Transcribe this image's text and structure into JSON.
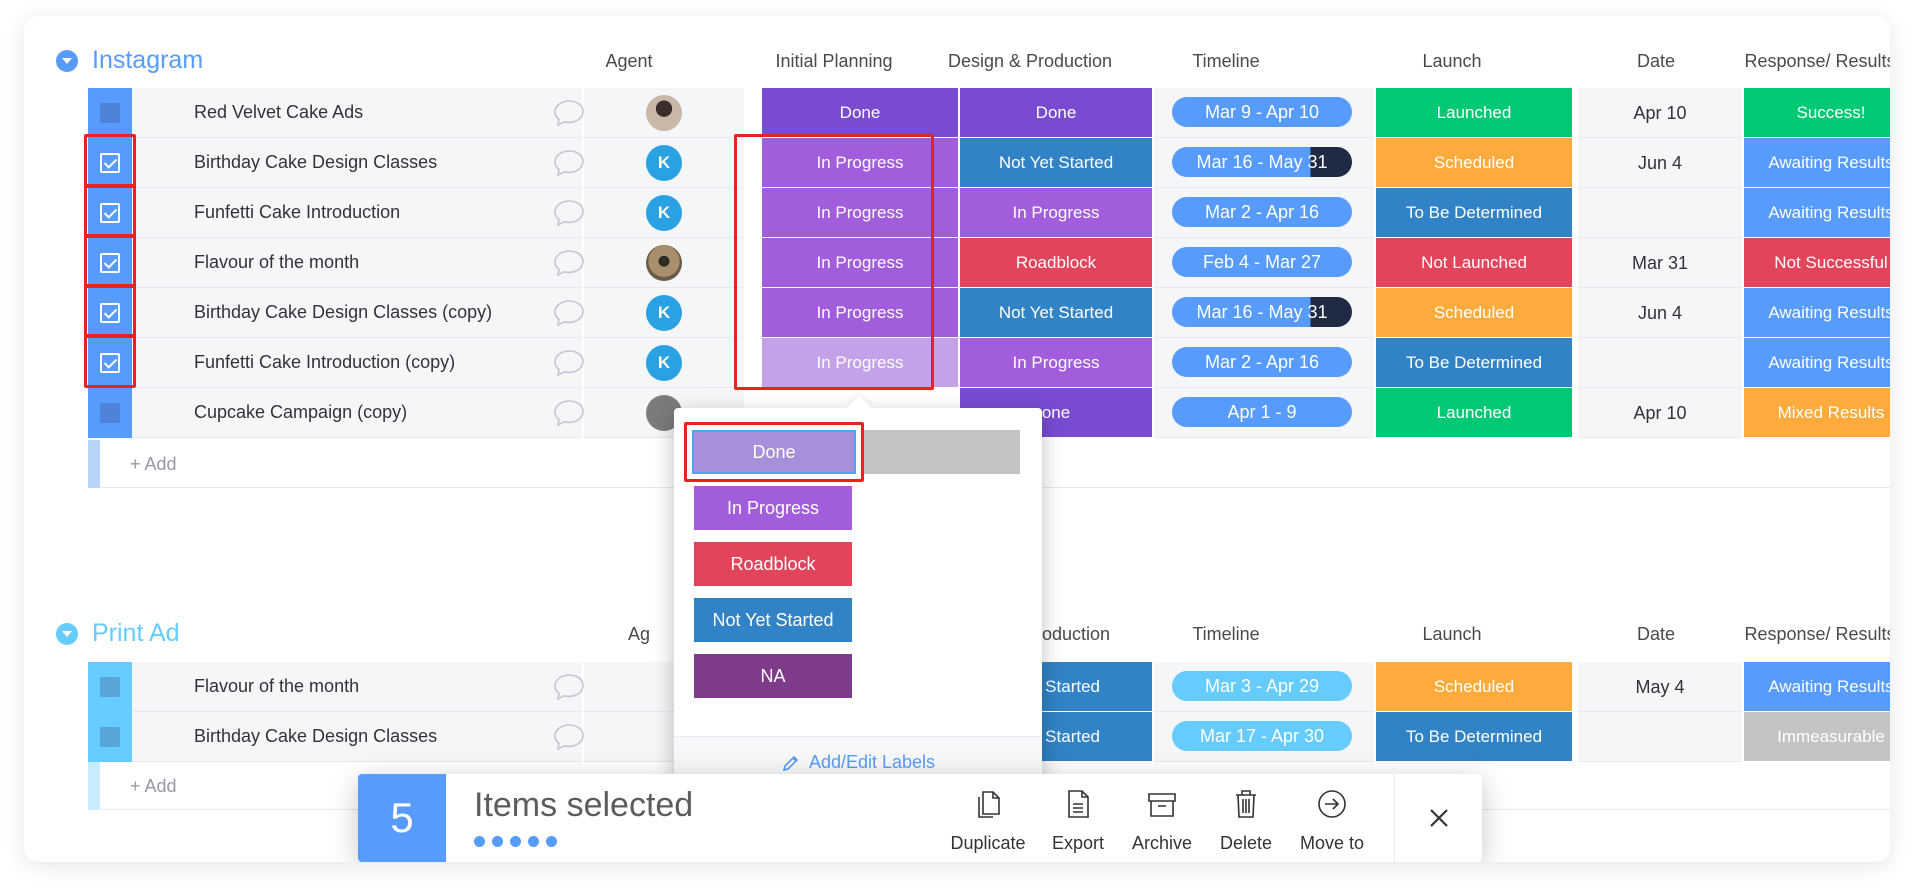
{
  "groups": [
    {
      "title": "Instagram",
      "columns": [
        "Agent",
        "Initial Planning",
        "Design & Production",
        "Timeline",
        "Launch",
        "Date",
        "Response/ Results"
      ],
      "rows": [
        {
          "name": "Red Velvet Cake Ads",
          "checked": false,
          "agent": "photo",
          "initial": "Done",
          "design": "Done",
          "timeline": "Mar 9 - Apr 10",
          "launch": "Launched",
          "date": "Apr 10",
          "response": "Success!"
        },
        {
          "name": "Birthday Cake Design Classes",
          "checked": true,
          "agent": "K",
          "initial": "In Progress",
          "design": "Not Yet Started",
          "timeline": "Mar 16 - May 31",
          "launch": "Scheduled",
          "date": "Jun 4",
          "response": "Awaiting Results"
        },
        {
          "name": "Funfetti Cake Introduction",
          "checked": true,
          "agent": "K",
          "initial": "In Progress",
          "design": "In Progress",
          "timeline": "Mar 2 - Apr 16",
          "launch": "To Be Determined",
          "date": "",
          "response": "Awaiting Results"
        },
        {
          "name": "Flavour of the month",
          "checked": true,
          "agent": "pug",
          "initial": "In Progress",
          "design": "Roadblock",
          "timeline": "Feb 4 - Mar 27",
          "launch": "Not Launched",
          "date": "Mar 31",
          "response": "Not Successful"
        },
        {
          "name": "Birthday Cake Design Classes (copy)",
          "checked": true,
          "agent": "K",
          "initial": "In Progress",
          "design": "Not Yet Started",
          "timeline": "Mar 16 - May 31",
          "launch": "Scheduled",
          "date": "Jun 4",
          "response": "Awaiting Results"
        },
        {
          "name": "Funfetti Cake Introduction (copy)",
          "checked": true,
          "agent": "K",
          "initial": "In Progress",
          "design": "In Progress",
          "timeline": "Mar 2 - Apr 16",
          "launch": "To Be Determined",
          "date": "",
          "response": "Awaiting Results"
        },
        {
          "name": "Cupcake Campaign (copy)",
          "checked": false,
          "agent": "",
          "initial": "",
          "design": "one",
          "timeline": "Apr 1 - 9",
          "launch": "Launched",
          "date": "Apr 10",
          "response": "Mixed Results"
        }
      ],
      "add_label": "+ Add"
    },
    {
      "title": "Print Ad",
      "columns": [
        "Ag",
        "Production",
        "Timeline",
        "Launch",
        "Date",
        "Response/ Results"
      ],
      "rows": [
        {
          "name": "Flavour of the month",
          "checked": false,
          "design": "et Started",
          "timeline": "Mar 3 - Apr 29",
          "launch": "Scheduled",
          "date": "May 4",
          "response": "Awaiting Results"
        },
        {
          "name": "Birthday Cake Design Classes",
          "checked": false,
          "design": "et Started",
          "timeline": "Mar 17 - Apr 30",
          "launch": "To Be Determined",
          "date": "",
          "response": "Immeasurable"
        }
      ],
      "add_label": "+ Add"
    }
  ],
  "agent_initial": "K",
  "dropdown": {
    "options": [
      "Done",
      "In Progress",
      "Roadblock",
      "Not Yet Started",
      "NA"
    ],
    "footer": "Add/Edit Labels"
  },
  "actionbar": {
    "count": "5",
    "text": "Items selected",
    "actions": [
      "Duplicate",
      "Export",
      "Archive",
      "Delete",
      "Move to"
    ]
  },
  "colors": {
    "accent": "#579bfc",
    "done": "#784bd1",
    "in_progress": "#a25ddc",
    "in_progress_hover": "#c4a2e8",
    "not_yet_started": "#3283c5",
    "roadblock": "#e2445c",
    "na": "#7e3b8a",
    "launched": "#00c875",
    "scheduled": "#fdab3d",
    "tbd": "#3283c5",
    "not_launched": "#e2445c",
    "success": "#00c875",
    "awaiting": "#579bfc",
    "not_successful": "#e2445c",
    "mixed": "#fdab3d",
    "immeasurable": "#c4c4c4",
    "timeline": "#579bfc",
    "timeline_light": "#66ccff",
    "highlight": "#e6231f"
  }
}
